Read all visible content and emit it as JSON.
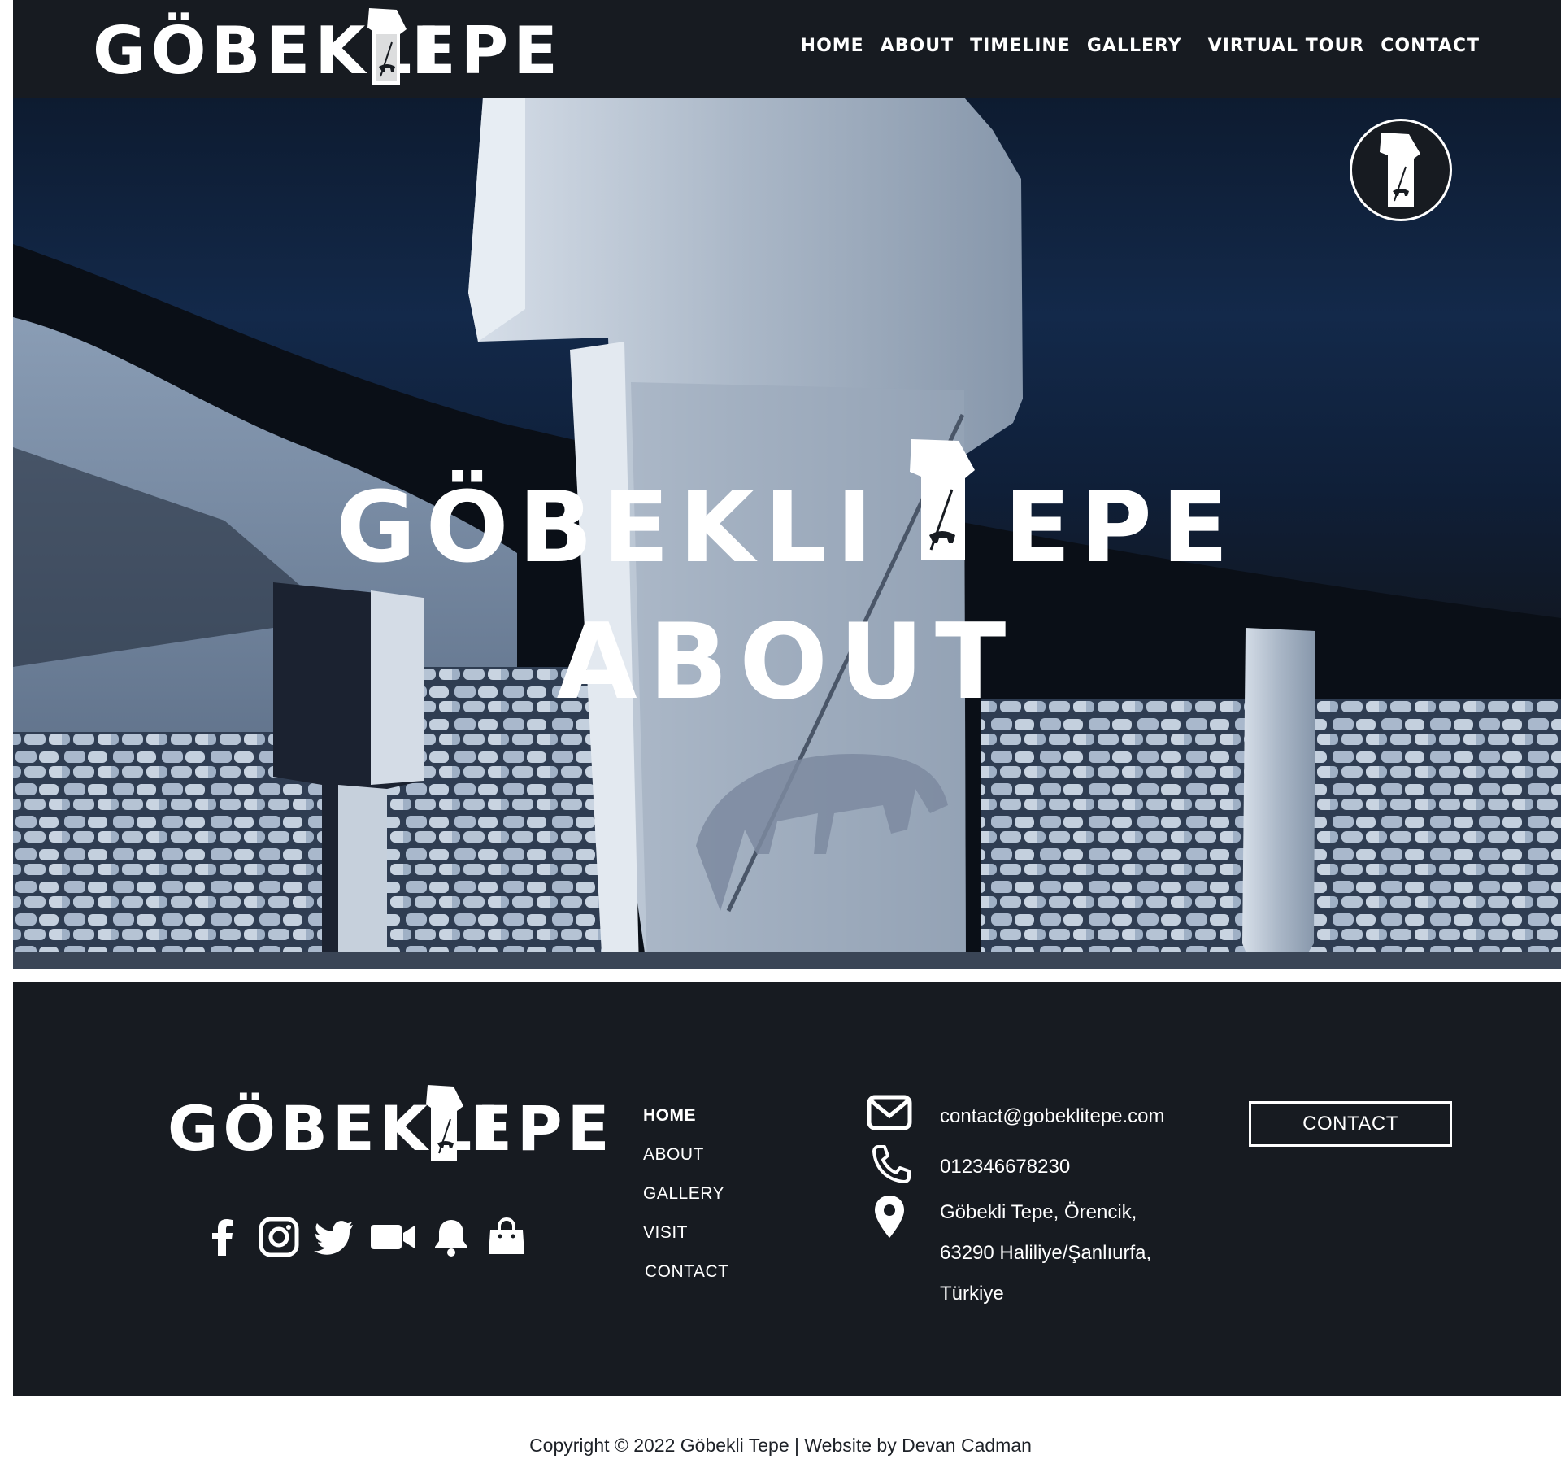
{
  "site": {
    "logo_text_prefix": "GÖBEKLI ",
    "logo_text_suffix": "EPE"
  },
  "header": {
    "nav": [
      {
        "label": "HOME"
      },
      {
        "label": "ABOUT"
      },
      {
        "label": "TIMELINE"
      },
      {
        "label": "GALLERY"
      },
      {
        "label": "VIRTUAL TOUR"
      },
      {
        "label": "CONTACT"
      }
    ]
  },
  "hero": {
    "subtitle": "ABOUT"
  },
  "footer": {
    "social_icons": [
      "facebook-icon",
      "instagram-icon",
      "twitter-icon",
      "video-icon",
      "bell-icon",
      "shopping-bag-icon"
    ],
    "nav": [
      {
        "label": "HOME",
        "active": true
      },
      {
        "label": "ABOUT"
      },
      {
        "label": "GALLERY"
      },
      {
        "label": "VISIT"
      },
      {
        "label": "CONTACT"
      }
    ],
    "contact": {
      "email": "contact@gobeklitepe.com",
      "phone": "012346678230",
      "address_line1": "Göbekli Tepe, Örencik,",
      "address_line2": "63290 Haliliye/Şanlıurfa,",
      "address_line3": "Türkiye"
    },
    "contact_button": "CONTACT"
  },
  "copyright": "Copyright © 2022 Göbekli Tepe | Website by Devan Cadman",
  "colors": {
    "dark": "#171b21",
    "white": "#ffffff",
    "night_sky": "#13294a",
    "stone": "#b9c6d6"
  }
}
